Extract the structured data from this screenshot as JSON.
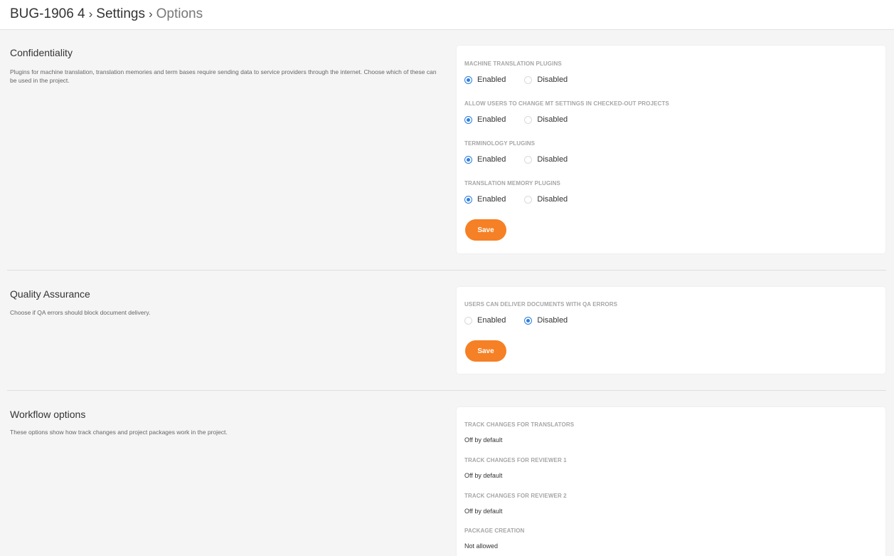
{
  "breadcrumb": {
    "items": [
      "BUG-1906 4",
      "Settings",
      "Options"
    ],
    "separator": "›"
  },
  "colors": {
    "accent": "#f58025",
    "radio_selected": "#2b7de0"
  },
  "confidentiality": {
    "title": "Confidentiality",
    "description": "Plugins for machine translation, translation memories and term bases require sending data to service providers through the internet. Choose which of these can be used in the project.",
    "fields": [
      {
        "label": "MACHINE TRANSLATION PLUGINS",
        "options": [
          "Enabled",
          "Disabled"
        ],
        "selected": "Enabled"
      },
      {
        "label": "ALLOW USERS TO CHANGE MT SETTINGS IN CHECKED-OUT PROJECTS",
        "options": [
          "Enabled",
          "Disabled"
        ],
        "selected": "Enabled"
      },
      {
        "label": "TERMINOLOGY PLUGINS",
        "options": [
          "Enabled",
          "Disabled"
        ],
        "selected": "Enabled"
      },
      {
        "label": "TRANSLATION MEMORY PLUGINS",
        "options": [
          "Enabled",
          "Disabled"
        ],
        "selected": "Enabled"
      }
    ],
    "save_label": "Save"
  },
  "quality_assurance": {
    "title": "Quality Assurance",
    "description": "Choose if QA errors should block document delivery.",
    "fields": [
      {
        "label": "USERS CAN DELIVER DOCUMENTS WITH QA ERRORS",
        "options": [
          "Enabled",
          "Disabled"
        ],
        "selected": "Disabled"
      }
    ],
    "save_label": "Save"
  },
  "workflow": {
    "title": "Workflow options",
    "description": "These options show how track changes and project packages work in the project.",
    "fields": [
      {
        "label": "TRACK CHANGES FOR TRANSLATORS",
        "value": "Off by default"
      },
      {
        "label": "TRACK CHANGES FOR REVIEWER 1",
        "value": "Off by default"
      },
      {
        "label": "TRACK CHANGES FOR REVIEWER 2",
        "value": "Off by default"
      },
      {
        "label": "PACKAGE CREATION",
        "value": "Not allowed"
      }
    ]
  }
}
